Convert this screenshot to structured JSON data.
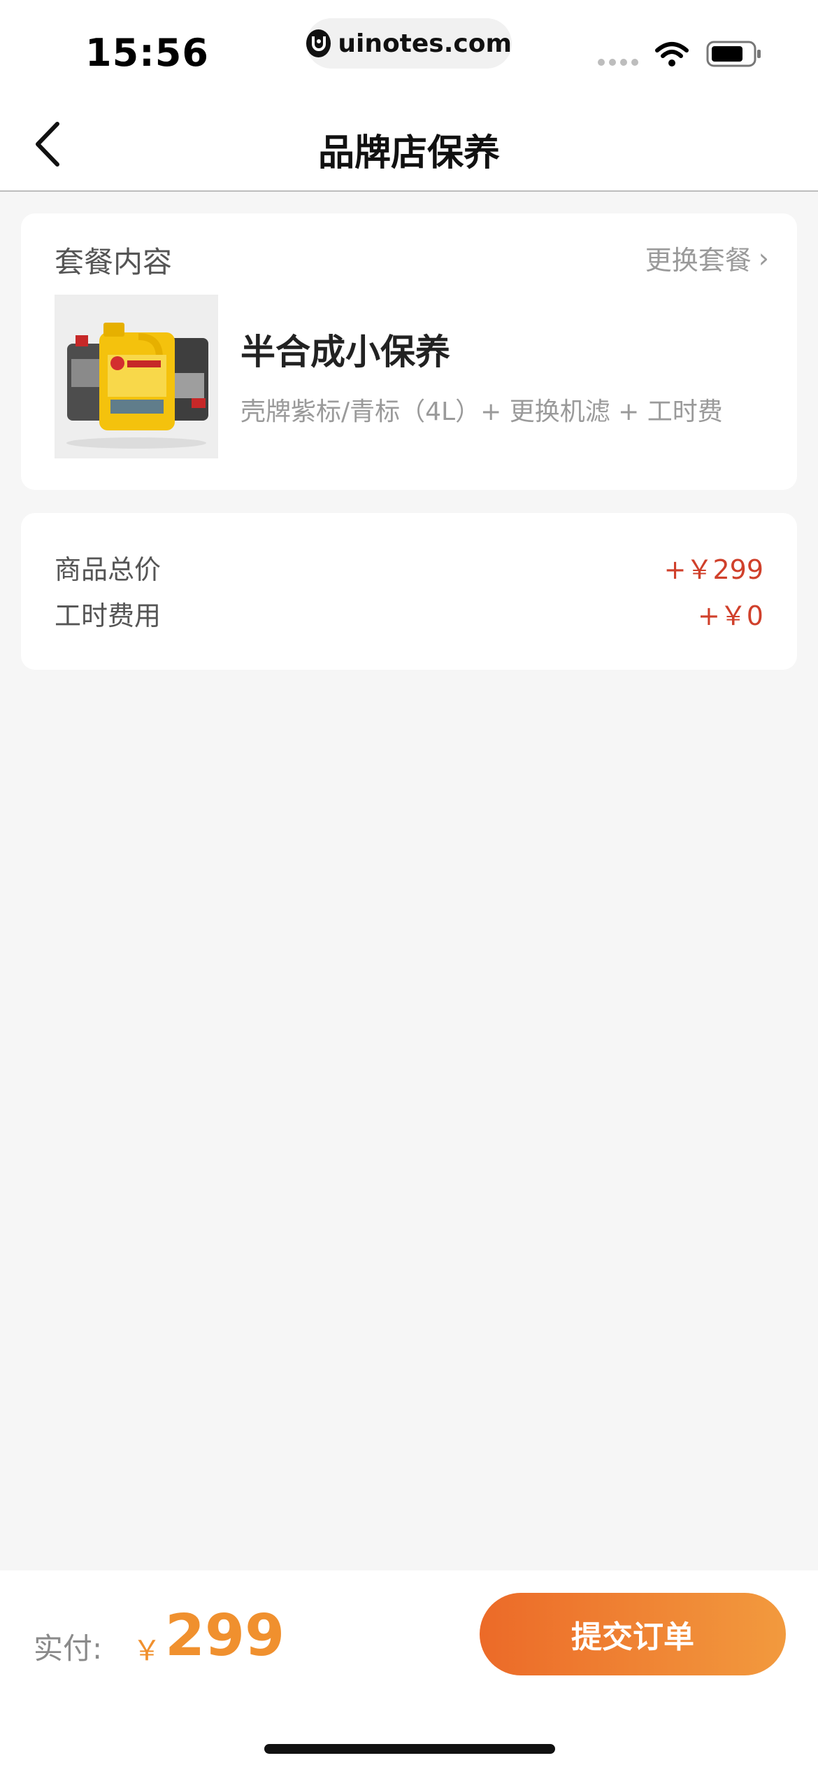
{
  "status_bar": {
    "time": "15:56",
    "url": "uinotes.com"
  },
  "header": {
    "title": "品牌店保养"
  },
  "package": {
    "section_label": "套餐内容",
    "change_label": "更换套餐",
    "name": "半合成小保养",
    "description": "壳牌紫标/青标（4L）+ 更换机滤 + 工时费"
  },
  "prices": [
    {
      "label": "商品总价",
      "value": "+￥299"
    },
    {
      "label": "工时费用",
      "value": "+￥0"
    }
  ],
  "footer": {
    "pay_label": "实付:",
    "currency": "￥",
    "amount": "299",
    "submit_label": "提交订单"
  },
  "colors": {
    "accent_orange": "#f0902e",
    "price_red": "#d0402b",
    "button_gradient_start": "#ec6a28",
    "button_gradient_end": "#f29a3e",
    "background": "#f6f6f6"
  },
  "icons": {
    "back": "chevron-left-icon",
    "change": "chevron-right-icon",
    "wifi": "wifi-icon",
    "battery": "battery-icon",
    "site_logo": "uinotes-logo-icon"
  }
}
